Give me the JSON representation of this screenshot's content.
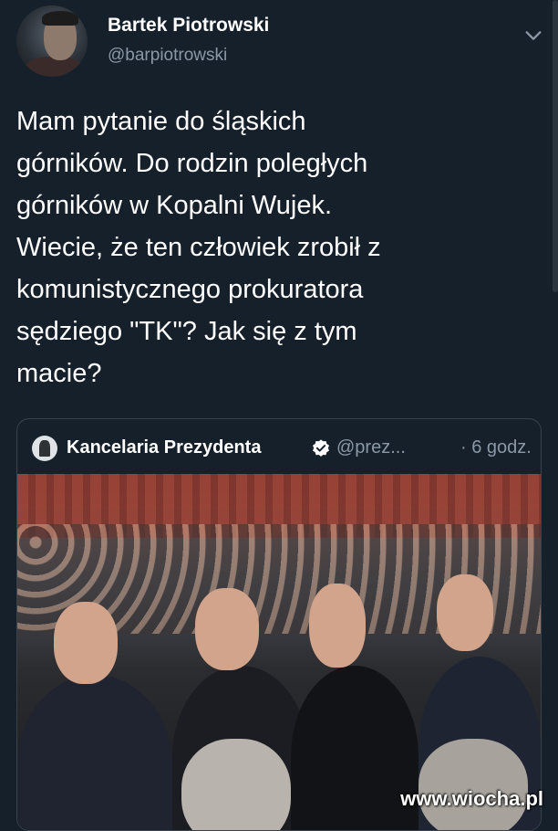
{
  "author": {
    "name": "Bartek Piotrowski",
    "handle": "@barpiotrowski"
  },
  "tweet": {
    "text": "Mam pytanie do śląskich\ngórników. Do rodzin poległych\ngórników w Kopalni Wujek.\nWiecie, że ten człowiek zrobił z\nkomunistycznego prokuratora\nsędziego \"TK\"? Jak się z tym\nmacie?"
  },
  "quoted_tweet": {
    "name": "Kancelaria Prezydenta",
    "handle": "@prez...",
    "time": "· 6 godz."
  },
  "watermark": "www.wiocha.pl",
  "icons": {
    "chevron": "chevron-down-icon",
    "verified": "verified-badge-icon"
  },
  "colors": {
    "background": "#15202b",
    "secondary_text": "#8b98a5",
    "verified": "#ffffff",
    "border": "#38444d"
  }
}
